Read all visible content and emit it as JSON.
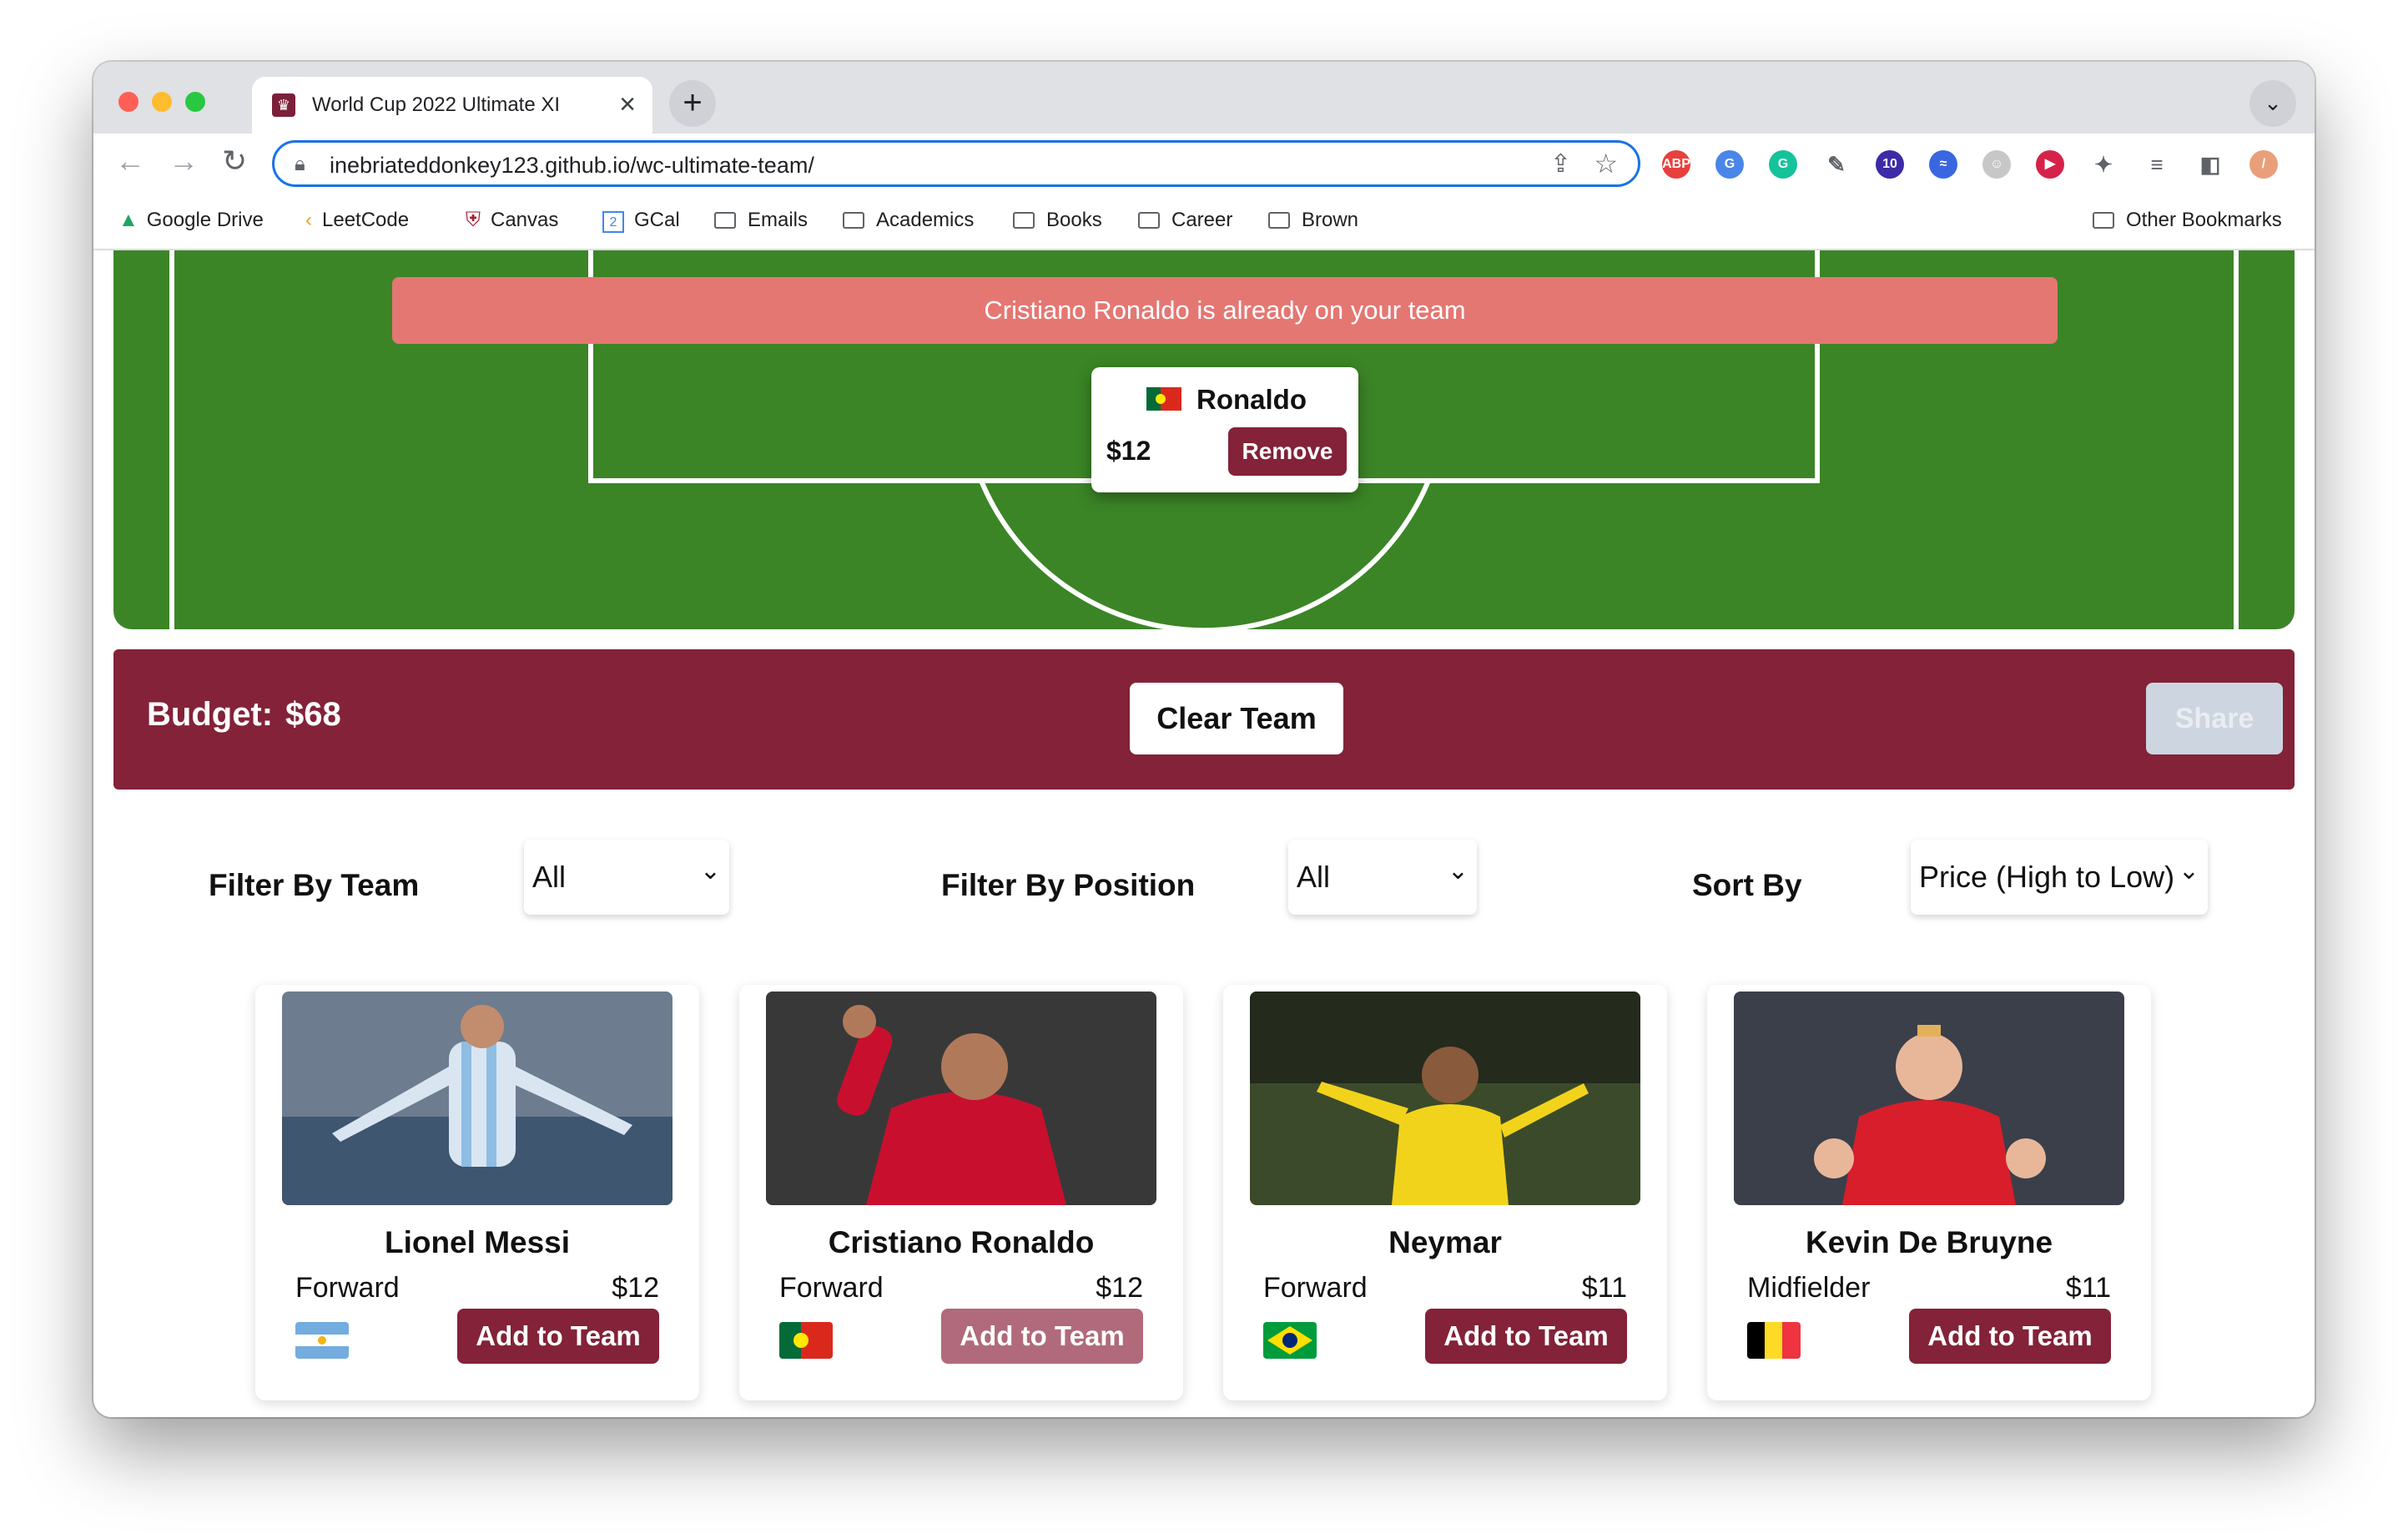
{
  "browser": {
    "tab_title": "World Cup 2022 Ultimate XI",
    "tab_close": "×",
    "new_tab": "+",
    "tab_menu": "⌄",
    "url": "inebriateddonkey123.github.io/wc-ultimate-team/",
    "extensions": [
      {
        "name": "adblock-icon",
        "label": "ABP",
        "color": "#e8403c"
      },
      {
        "name": "translate-icon",
        "label": "G",
        "color": "#4a86e8"
      },
      {
        "name": "grammarly-icon",
        "label": "G",
        "color": "#15c39a"
      },
      {
        "name": "eyedropper-icon",
        "label": "✎",
        "color": "#5f6368"
      },
      {
        "name": "scholar-icon",
        "label": "10",
        "color": "#3c2aa8"
      },
      {
        "name": "wave-icon",
        "label": "≈",
        "color": "#3a66e0"
      },
      {
        "name": "ghost-icon",
        "label": "☺",
        "color": "#c7c7c7"
      },
      {
        "name": "record-icon",
        "label": "▶",
        "color": "#d6224a"
      },
      {
        "name": "puzzle-icon",
        "label": "✦",
        "color": "#5f6368"
      },
      {
        "name": "playlist-icon",
        "label": "≡",
        "color": "#5f6368"
      },
      {
        "name": "sidepanel-icon",
        "label": "◧",
        "color": "#5f6368"
      },
      {
        "name": "profile-icon",
        "label": "/",
        "color": "#e9a07a"
      },
      {
        "name": "menu-icon",
        "label": "⋮",
        "color": "#5f6368"
      }
    ]
  },
  "bookmarks": {
    "items": [
      "Google Drive",
      "LeetCode",
      "Canvas",
      "GCal",
      "Emails",
      "Academics",
      "Books",
      "Career",
      "Brown"
    ],
    "other": "Other Bookmarks"
  },
  "pitch": {
    "alert": "Cristiano Ronaldo is already on your team",
    "selected_player": {
      "name": "Ronaldo",
      "price": "$12",
      "remove_label": "Remove"
    }
  },
  "budget": {
    "label": "Budget:",
    "value": "$68",
    "clear_label": "Clear Team",
    "share_label": "Share"
  },
  "filters": {
    "team_label": "Filter By Team",
    "team_value": "All",
    "position_label": "Filter By Position",
    "position_value": "All",
    "sort_label": "Sort By",
    "sort_value": "Price (High to Low)",
    "chevron": "⌄"
  },
  "players": [
    {
      "name": "Lionel Messi",
      "position": "Forward",
      "price": "$12",
      "add_label": "Add to Team"
    },
    {
      "name": "Cristiano Ronaldo",
      "position": "Forward",
      "price": "$12",
      "add_label": "Add to Team"
    },
    {
      "name": "Neymar",
      "position": "Forward",
      "price": "$11",
      "add_label": "Add to Team"
    },
    {
      "name": "Kevin De Bruyne",
      "position": "Midfielder",
      "price": "$11",
      "add_label": "Add to Team"
    }
  ],
  "colors": {
    "brand": "#832238",
    "pitch": "#3b8526",
    "alert": "#e57773"
  }
}
